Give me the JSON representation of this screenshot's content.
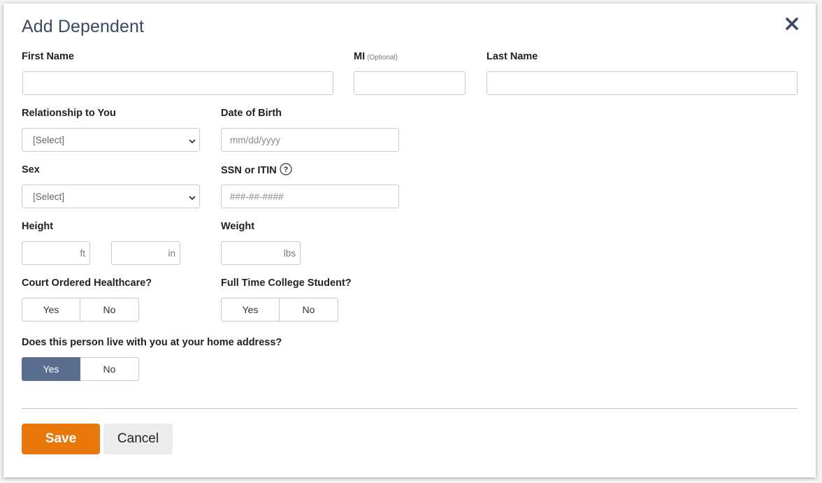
{
  "dialog": {
    "title": "Add Dependent",
    "close_icon": "close-icon"
  },
  "fields": {
    "first_name": {
      "label": "First Name",
      "value": "",
      "placeholder": ""
    },
    "mi": {
      "label": "MI",
      "optional_text": "(Optional)",
      "value": "",
      "placeholder": ""
    },
    "last_name": {
      "label": "Last Name",
      "value": "",
      "placeholder": ""
    },
    "relationship": {
      "label": "Relationship to You",
      "selected": "[Select]"
    },
    "dob": {
      "label": "Date of Birth",
      "value": "",
      "placeholder": "mm/dd/yyyy"
    },
    "sex": {
      "label": "Sex",
      "selected": "[Select]"
    },
    "ssn": {
      "label": "SSN or ITIN",
      "value": "",
      "placeholder": "###-##-####",
      "help_icon": "help-circle-icon"
    },
    "height": {
      "label": "Height",
      "ft_unit": "ft",
      "in_unit": "in"
    },
    "weight": {
      "label": "Weight",
      "unit": "lbs"
    }
  },
  "questions": {
    "court_ordered": {
      "label": "Court Ordered Healthcare?",
      "yes": "Yes",
      "no": "No",
      "selected": null
    },
    "college_student": {
      "label": "Full Time College Student?",
      "yes": "Yes",
      "no": "No",
      "selected": null
    },
    "lives_with_you": {
      "label": "Does this person live with you at your home address?",
      "yes": "Yes",
      "no": "No",
      "selected": "Yes"
    }
  },
  "actions": {
    "save_label": "Save",
    "cancel_label": "Cancel"
  },
  "colors": {
    "title": "#3b4a63",
    "save_button": "#e8770c",
    "toggle_active": "#5a6f8f",
    "cancel_button": "#ececec"
  }
}
